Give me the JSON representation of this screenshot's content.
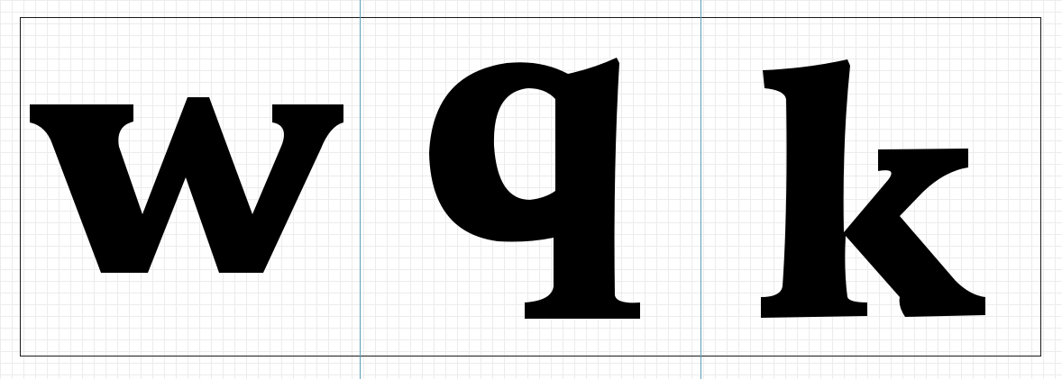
{
  "glyphs": [
    {
      "char": "w",
      "name": "letter-w"
    },
    {
      "char": "q",
      "name": "letter-q"
    },
    {
      "char": "k",
      "name": "letter-k"
    }
  ],
  "colors": {
    "background": "#ffffff",
    "grid": "#ececec",
    "frame": "#1a1a1a",
    "guide": "#5b9fb8",
    "glyph": "#000000"
  }
}
